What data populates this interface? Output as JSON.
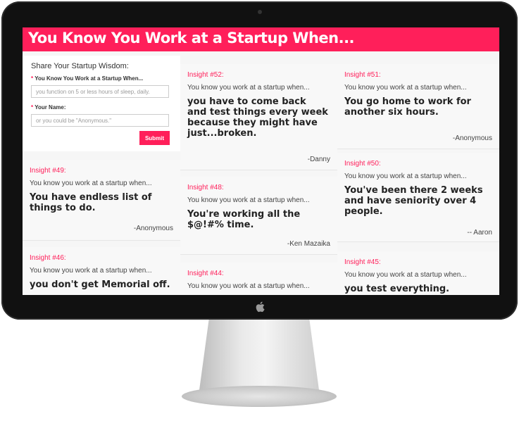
{
  "site": {
    "title": "You Know You Work at a Startup When..."
  },
  "form": {
    "heading": "Share Your Startup Wisdom:",
    "field1_label": "You Know You Work at a Startup When...",
    "field1_placeholder": "you function on 5 or less hours of sleep, daily.",
    "field2_label": "Your Name:",
    "field2_placeholder": "or you could be \"Anonymous.\"",
    "required_mark": "*",
    "submit_label": "Submit"
  },
  "lead": "You know you work at a startup when...",
  "cards": [
    {
      "id": "Insight #49:",
      "message": "You have endless list of things to do.",
      "author": "-Anonymous"
    },
    {
      "id": "Insight #46:",
      "message": "you don't get Memorial off.",
      "author": ""
    },
    {
      "id": "Insight #52:",
      "message": "you have to come back and test things every week because they might have just...broken.",
      "author": "-Danny"
    },
    {
      "id": "Insight #48:",
      "message": "You're working all the $@!#% time.",
      "author": "-Ken Mazaika"
    },
    {
      "id": "Insight #44:",
      "message": "",
      "author": ""
    },
    {
      "id": "Insight #51:",
      "message": "You go home to work for another six hours.",
      "author": "-Anonymous"
    },
    {
      "id": "Insight #50:",
      "message": "You've been there 2 weeks and have seniority over 4 people.",
      "author": "-- Aaron"
    },
    {
      "id": "Insight #45:",
      "message": "you test everything.",
      "author": ""
    }
  ]
}
